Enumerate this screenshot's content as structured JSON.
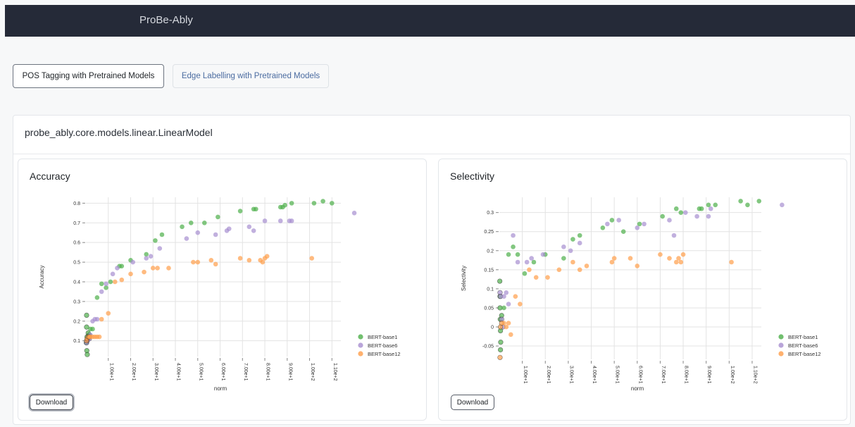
{
  "app": {
    "brand": "ProBe-Ably"
  },
  "tabs": [
    {
      "label": "POS Tagging with Pretrained Models",
      "active": true
    },
    {
      "label": "Edge Labelling with Pretrained Models",
      "active": false
    }
  ],
  "model_section": {
    "title": "probe_ably.core.models.linear.LinearModel"
  },
  "download_label": "Download",
  "colors": {
    "BERT-base1": "#4daf4a",
    "BERT-base6": "#a78fd0",
    "BERT-base12": "#ff9e4a"
  },
  "chart_data": [
    {
      "type": "scatter",
      "title": "Accuracy",
      "xlabel": "norm",
      "ylabel": "Accuracy",
      "xlim": [
        0,
        114
      ],
      "ylim": [
        0.02,
        0.83
      ],
      "xticks": [
        10,
        20,
        30,
        40,
        50,
        60,
        70,
        80,
        90,
        100,
        110
      ],
      "xtick_labels": [
        "1.00e+1",
        "2.00e+1",
        "3.00e+1",
        "4.00e+1",
        "5.00e+1",
        "6.00e+1",
        "7.00e+1",
        "8.00e+1",
        "9.00e+1",
        "1.00e+2",
        "1.10e+2"
      ],
      "yticks": [
        0.1,
        0.2,
        0.3,
        0.4,
        0.5,
        0.6,
        0.7,
        0.8
      ],
      "ytick_labels": [
        "0.1",
        "0.2",
        "0.3",
        "0.4",
        "0.5",
        "0.6",
        "0.7",
        "0.8"
      ],
      "grid": true,
      "legend_position": "right",
      "series": [
        {
          "name": "BERT-base1",
          "points": [
            [
              0.3,
              0.23
            ],
            [
              0.3,
              0.17
            ],
            [
              0.5,
              0.12
            ],
            [
              0.2,
              0.09
            ],
            [
              0.4,
              0.05
            ],
            [
              0.6,
              0.03
            ],
            [
              1,
              0.14
            ],
            [
              1.5,
              0.13
            ],
            [
              2,
              0.16
            ],
            [
              3,
              0.16
            ],
            [
              5,
              0.32
            ],
            [
              7,
              0.39
            ],
            [
              9,
              0.37
            ],
            [
              11,
              0.4
            ],
            [
              15,
              0.48
            ],
            [
              16,
              0.48
            ],
            [
              20,
              0.51
            ],
            [
              27,
              0.54
            ],
            [
              31,
              0.61
            ],
            [
              34,
              0.64
            ],
            [
              43,
              0.68
            ],
            [
              47,
              0.7
            ],
            [
              53,
              0.7
            ],
            [
              59,
              0.73
            ],
            [
              69,
              0.76
            ],
            [
              75,
              0.77
            ],
            [
              76,
              0.77
            ],
            [
              87,
              0.78
            ],
            [
              88,
              0.78
            ],
            [
              89,
              0.79
            ],
            [
              92,
              0.8
            ],
            [
              102,
              0.8
            ],
            [
              106,
              0.81
            ],
            [
              110,
              0.8
            ]
          ]
        },
        {
          "name": "BERT-base6",
          "points": [
            [
              0.3,
              0.09
            ],
            [
              0.5,
              0.1
            ],
            [
              1,
              0.11
            ],
            [
              1.5,
              0.11
            ],
            [
              2,
              0.13
            ],
            [
              3,
              0.2
            ],
            [
              4,
              0.21
            ],
            [
              5,
              0.21
            ],
            [
              7,
              0.35
            ],
            [
              9,
              0.39
            ],
            [
              12,
              0.44
            ],
            [
              14,
              0.47
            ],
            [
              21,
              0.5
            ],
            [
              27,
              0.52
            ],
            [
              29,
              0.53
            ],
            [
              33,
              0.57
            ],
            [
              45,
              0.62
            ],
            [
              50,
              0.65
            ],
            [
              58,
              0.64
            ],
            [
              63,
              0.66
            ],
            [
              64,
              0.67
            ],
            [
              73,
              0.68
            ],
            [
              75,
              0.66
            ],
            [
              80,
              0.71
            ],
            [
              87,
              0.71
            ],
            [
              91,
              0.71
            ],
            [
              92,
              0.71
            ],
            [
              120,
              0.75
            ]
          ]
        },
        {
          "name": "BERT-base12",
          "points": [
            [
              0.3,
              0.1
            ],
            [
              0.5,
              0.11
            ],
            [
              1,
              0.12
            ],
            [
              1.5,
              0.12
            ],
            [
              2,
              0.12
            ],
            [
              3,
              0.12
            ],
            [
              4,
              0.12
            ],
            [
              5,
              0.12
            ],
            [
              6,
              0.12
            ],
            [
              7,
              0.21
            ],
            [
              10,
              0.24
            ],
            [
              13,
              0.4
            ],
            [
              16,
              0.41
            ],
            [
              20,
              0.44
            ],
            [
              26,
              0.45
            ],
            [
              30,
              0.47
            ],
            [
              32,
              0.47
            ],
            [
              37,
              0.47
            ],
            [
              48,
              0.5
            ],
            [
              50,
              0.5
            ],
            [
              56,
              0.51
            ],
            [
              58,
              0.49
            ],
            [
              69,
              0.52
            ],
            [
              73,
              0.51
            ],
            [
              78,
              0.51
            ],
            [
              79,
              0.5
            ],
            [
              80,
              0.52
            ],
            [
              81,
              0.53
            ],
            [
              101,
              0.52
            ]
          ]
        }
      ]
    },
    {
      "type": "scatter",
      "title": "Selectivity",
      "xlabel": "norm",
      "ylabel": "Selectivity",
      "xlim": [
        0,
        114
      ],
      "ylim": [
        -0.085,
        0.34
      ],
      "xticks": [
        10,
        20,
        30,
        40,
        50,
        60,
        70,
        80,
        90,
        100,
        110
      ],
      "xtick_labels": [
        "1.00e+1",
        "2.00e+1",
        "3.00e+1",
        "4.00e+1",
        "5.00e+1",
        "6.00e+1",
        "7.00e+1",
        "8.00e+1",
        "9.00e+1",
        "1.00e+2",
        "1.10e+2"
      ],
      "yticks": [
        -0.05,
        0,
        0.05,
        0.1,
        0.15,
        0.2,
        0.25,
        0.3
      ],
      "ytick_labels": [
        "-0.05",
        "0",
        "0.05",
        "0.1",
        "0.15",
        "0.2",
        "0.25",
        "0.3"
      ],
      "grid": true,
      "legend_position": "right",
      "series": [
        {
          "name": "BERT-base1",
          "points": [
            [
              0.2,
              0.12
            ],
            [
              0.3,
              0.08
            ],
            [
              0.3,
              0.05
            ],
            [
              0.4,
              0.02
            ],
            [
              0.5,
              -0.01
            ],
            [
              0.6,
              -0.04
            ],
            [
              0.5,
              -0.06
            ],
            [
              1,
              0.03
            ],
            [
              2,
              0.05
            ],
            [
              4,
              0.19
            ],
            [
              6,
              0.21
            ],
            [
              8,
              0.19
            ],
            [
              11,
              0.14
            ],
            [
              15,
              0.17
            ],
            [
              20,
              0.19
            ],
            [
              28,
              0.18
            ],
            [
              32,
              0.23
            ],
            [
              35,
              0.24
            ],
            [
              45,
              0.26
            ],
            [
              49,
              0.28
            ],
            [
              54,
              0.25
            ],
            [
              61,
              0.27
            ],
            [
              71,
              0.29
            ],
            [
              77,
              0.31
            ],
            [
              79,
              0.3
            ],
            [
              87,
              0.31
            ],
            [
              88,
              0.31
            ],
            [
              91,
              0.32
            ],
            [
              94,
              0.32
            ],
            [
              105,
              0.33
            ],
            [
              108,
              0.32
            ],
            [
              113,
              0.33
            ]
          ]
        },
        {
          "name": "BERT-base6",
          "points": [
            [
              0.3,
              0.09
            ],
            [
              0.5,
              0.08
            ],
            [
              1,
              0.02
            ],
            [
              1.5,
              0.0
            ],
            [
              2,
              0.08
            ],
            [
              3,
              0.09
            ],
            [
              4,
              0.06
            ],
            [
              6,
              0.24
            ],
            [
              8,
              0.17
            ],
            [
              12,
              0.17
            ],
            [
              14,
              0.18
            ],
            [
              19,
              0.19
            ],
            [
              28,
              0.21
            ],
            [
              31,
              0.2
            ],
            [
              35,
              0.22
            ],
            [
              47,
              0.27
            ],
            [
              52,
              0.28
            ],
            [
              60,
              0.26
            ],
            [
              63,
              0.27
            ],
            [
              74,
              0.28
            ],
            [
              76,
              0.24
            ],
            [
              81,
              0.3
            ],
            [
              86,
              0.29
            ],
            [
              91,
              0.29
            ],
            [
              92,
              0.31
            ],
            [
              123,
              0.32
            ]
          ]
        },
        {
          "name": "BERT-base12",
          "points": [
            [
              0.3,
              -0.08
            ],
            [
              0.5,
              0.0
            ],
            [
              1,
              0.01
            ],
            [
              2,
              0.01
            ],
            [
              3,
              0.0
            ],
            [
              4,
              0.01
            ],
            [
              5,
              -0.02
            ],
            [
              7,
              0.08
            ],
            [
              9,
              0.06
            ],
            [
              13,
              0.15
            ],
            [
              16,
              0.13
            ],
            [
              21,
              0.13
            ],
            [
              26,
              0.15
            ],
            [
              32,
              0.17
            ],
            [
              35,
              0.15
            ],
            [
              38,
              0.16
            ],
            [
              49,
              0.17
            ],
            [
              50,
              0.18
            ],
            [
              57,
              0.18
            ],
            [
              60,
              0.16
            ],
            [
              70,
              0.19
            ],
            [
              74,
              0.18
            ],
            [
              77,
              0.17
            ],
            [
              78,
              0.18
            ],
            [
              79,
              0.17
            ],
            [
              80,
              0.19
            ],
            [
              101,
              0.17
            ]
          ]
        }
      ]
    }
  ]
}
